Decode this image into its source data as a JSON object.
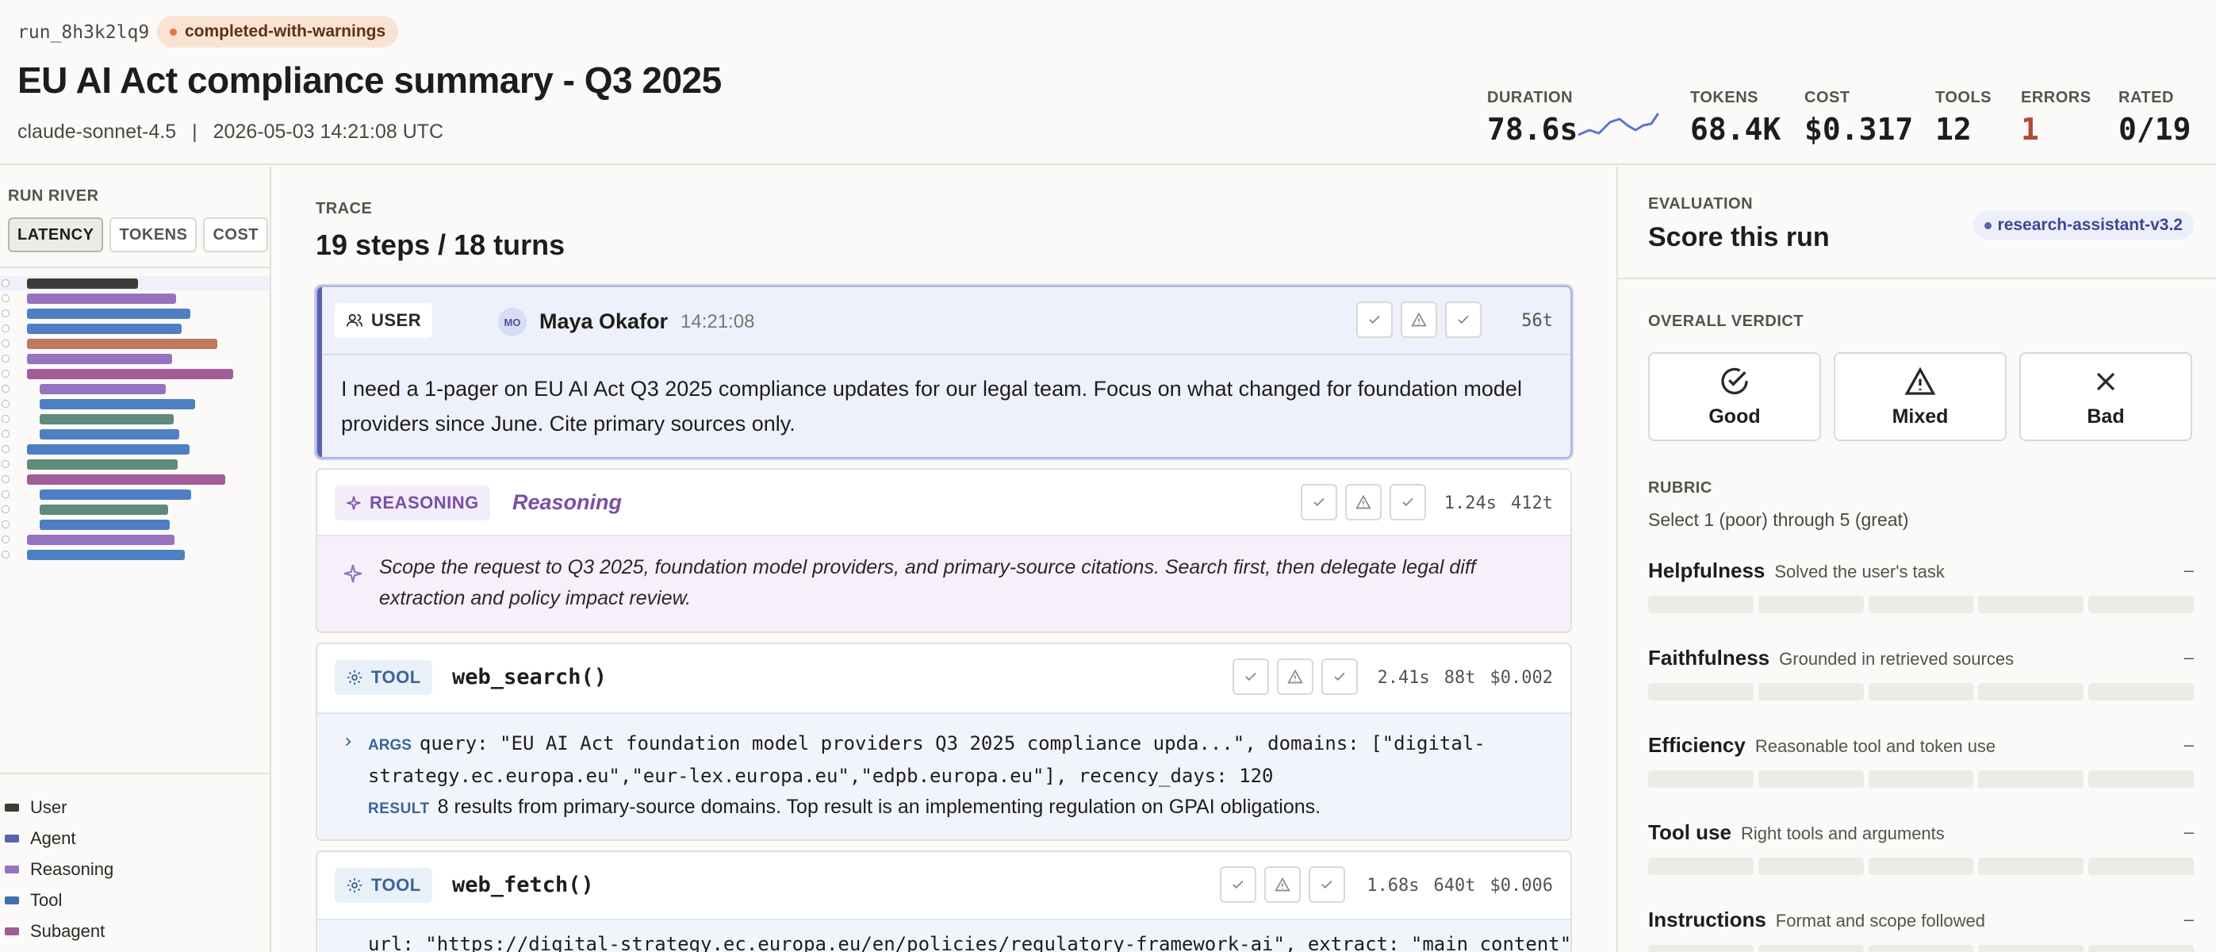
{
  "header": {
    "run_id": "run_8h3k2lq9",
    "status": "completed-with-warnings",
    "title": "EU AI Act compliance summary - Q3 2025",
    "model": "claude-sonnet-4.5",
    "separator": "|",
    "timestamp": "2026-05-03 14:21:08 UTC",
    "stats": [
      {
        "label": "DURATION",
        "value": "78.6s"
      },
      {
        "label": "TOKENS",
        "value": "68.4K"
      },
      {
        "label": "COST",
        "value": "$0.317"
      },
      {
        "label": "TOOLS",
        "value": "12"
      },
      {
        "label": "ERRORS",
        "value": "1"
      },
      {
        "label": "RATED",
        "value": "0/19"
      }
    ]
  },
  "river": {
    "title": "RUN RIVER",
    "tabs": [
      "LATENCY",
      "TOKENS",
      "COST"
    ],
    "active_tab": "LATENCY",
    "rows": [
      {
        "kind": "user"
      },
      {
        "kind": "reasoning"
      },
      {
        "kind": "tool"
      },
      {
        "kind": "tool"
      },
      {
        "kind": "error"
      },
      {
        "kind": "reasoning"
      },
      {
        "kind": "subagent"
      },
      {
        "kind": "reasoning"
      },
      {
        "kind": "tool"
      },
      {
        "kind": "agentgreen"
      },
      {
        "kind": "tool"
      },
      {
        "kind": "tool"
      },
      {
        "kind": "agentgreen"
      },
      {
        "kind": "subagent"
      },
      {
        "kind": "tool"
      },
      {
        "kind": "agentgreen"
      },
      {
        "kind": "tool"
      },
      {
        "kind": "reasoning"
      },
      {
        "kind": "tool"
      }
    ],
    "legend": [
      {
        "label": "User",
        "color": "#3d3b37"
      },
      {
        "label": "Agent",
        "color": "#5a62ad"
      },
      {
        "label": "Reasoning",
        "color": "#9673bf"
      },
      {
        "label": "Tool",
        "color": "#3f6fb3"
      },
      {
        "label": "Subagent",
        "color": "#a25c97"
      }
    ]
  },
  "trace": {
    "label": "TRACE",
    "heading": "19 steps / 18 turns",
    "user": {
      "kind": "USER",
      "avatar": "MO",
      "name": "Maya Okafor",
      "time": "14:21:08",
      "tokens": "56t",
      "text": "I need a 1-pager on EU AI Act Q3 2025 compliance updates for our legal team. Focus on what changed for foundation model providers since June. Cite primary sources only."
    },
    "reasoning": {
      "kind": "REASONING",
      "title": "Reasoning",
      "duration": "1.24s",
      "tokens": "412t",
      "text": "Scope the request to Q3 2025, foundation model providers, and primary-source citations. Search first, then delegate legal diff extraction and policy impact review."
    },
    "tool1": {
      "kind": "TOOL",
      "name": "web_search()",
      "duration": "2.41s",
      "tokens": "88t",
      "cost": "$0.002",
      "args_label": "ARGS",
      "args_line1": "query: \"EU AI Act foundation model providers Q3 2025 compliance upda...\", domains: [\"digital-",
      "args_line2": "strategy.ec.europa.eu\",\"eur-lex.europa.eu\",\"edpb.europa.eu\"], recency_days: 120",
      "result_label": "RESULT",
      "result": "8 results from primary-source domains. Top result is an implementing regulation on GPAI obligations."
    },
    "tool2": {
      "kind": "TOOL",
      "name": "web_fetch()",
      "duration": "1.68s",
      "tokens": "640t",
      "cost": "$0.006",
      "args_partial": "url: \"https://digital-strategy.ec.europa.eu/en/policies/regulatory-framework-ai\", extract: \"main_content\""
    }
  },
  "evaluation": {
    "label": "EVALUATION",
    "title": "Score this run",
    "rubric_badge": "research-assistant-v3.2",
    "verdict_label": "OVERALL VERDICT",
    "verdicts": [
      "Good",
      "Mixed",
      "Bad"
    ],
    "rubric_label": "RUBRIC",
    "rubric_hint": "Select 1 (poor) through 5 (great)",
    "criteria": [
      {
        "name": "Helpfulness",
        "desc": "Solved the user's task",
        "value": "–"
      },
      {
        "name": "Faithfulness",
        "desc": "Grounded in retrieved sources",
        "value": "–"
      },
      {
        "name": "Efficiency",
        "desc": "Reasonable tool and token use",
        "value": "–"
      },
      {
        "name": "Tool use",
        "desc": "Right tools and arguments",
        "value": "–"
      },
      {
        "name": "Instructions",
        "desc": "Format and scope followed",
        "value": "–"
      }
    ]
  },
  "colors": {
    "user": "#3d3b37",
    "reasoning": "#9673bf",
    "tool": "#4f7fc3",
    "subagent": "#a25c97",
    "error": "#c0785f",
    "agentgreen": "#5f8a7c",
    "accent": "#5a62ad",
    "error_text": "#b4493a"
  }
}
